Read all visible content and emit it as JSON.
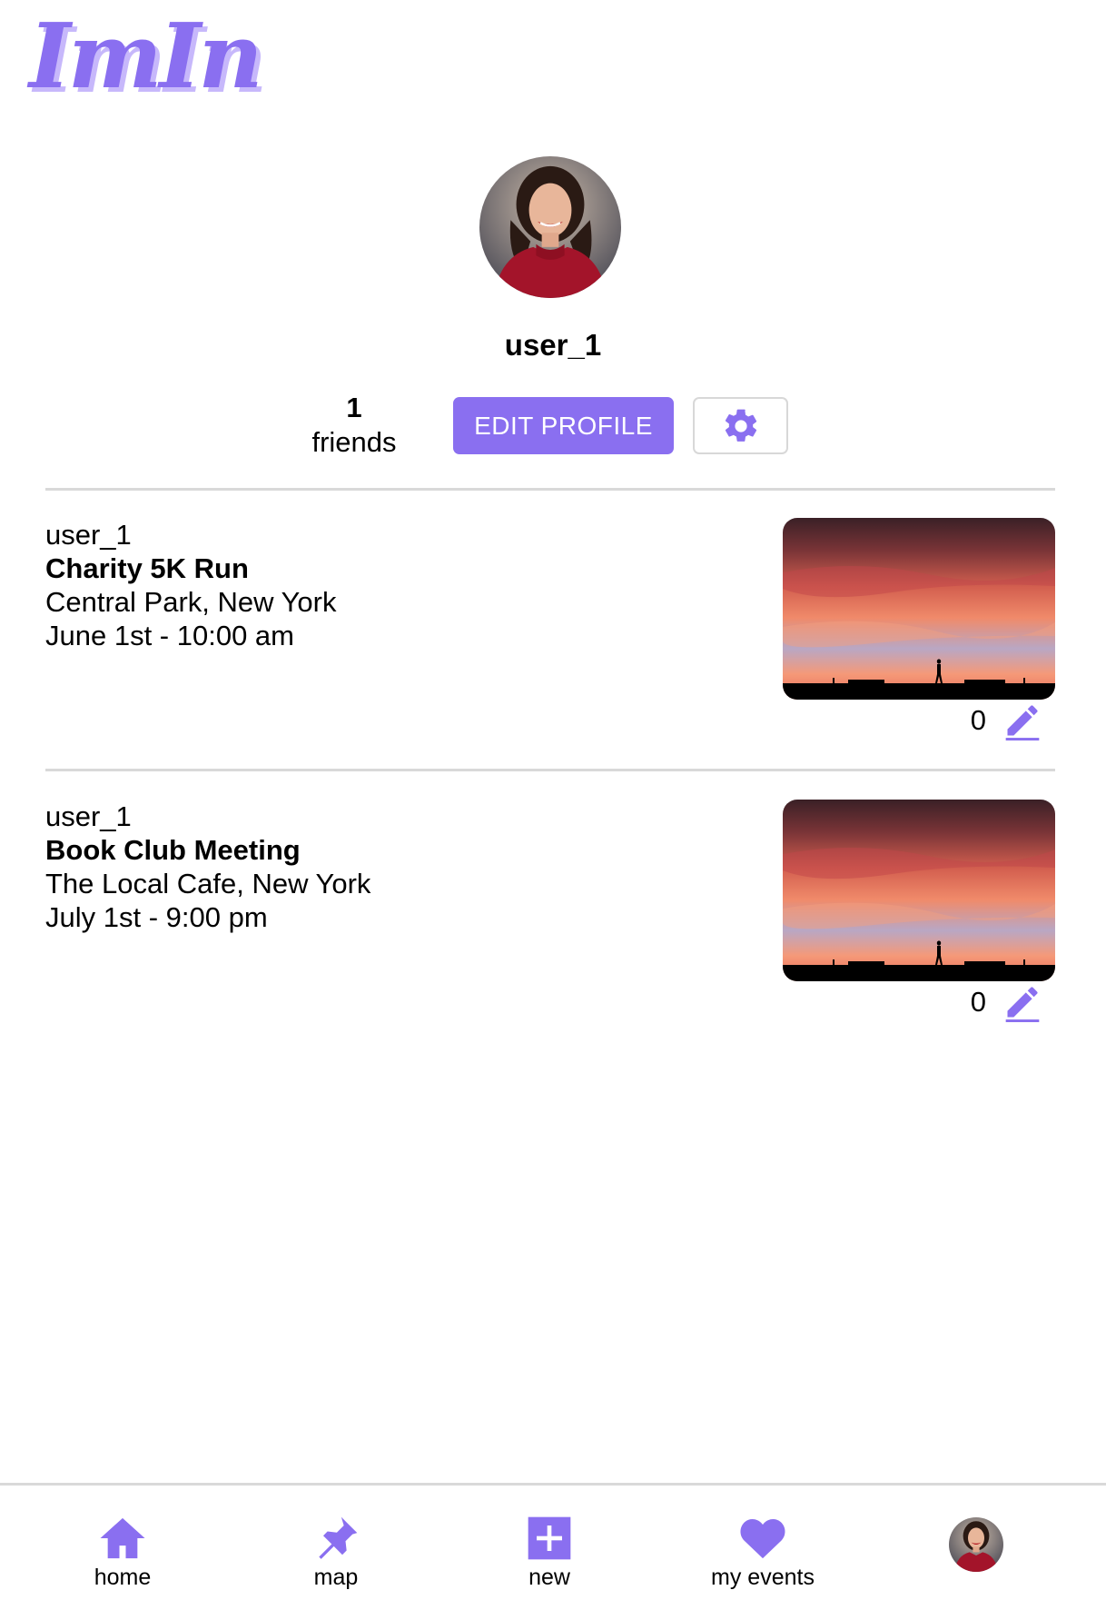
{
  "app": {
    "logo_text": "ImIn",
    "accent_color": "#8a6ff0"
  },
  "profile": {
    "username": "user_1",
    "friends_count": "1",
    "friends_label": "friends",
    "edit_profile_label": "EDIT PROFILE",
    "avatar_alt": "profile photo"
  },
  "events": [
    {
      "author": "user_1",
      "title": "Charity 5K Run",
      "location": "Central Park, New York",
      "datetime": "June 1st - 10:00 am",
      "count": "0",
      "image_alt": "sunset silhouette"
    },
    {
      "author": "user_1",
      "title": "Book Club Meeting",
      "location": "The Local Cafe, New York",
      "datetime": "July 1st - 9:00 pm",
      "count": "0",
      "image_alt": "sunset silhouette"
    }
  ],
  "nav": {
    "items": [
      {
        "label": "home",
        "icon": "home-icon"
      },
      {
        "label": "map",
        "icon": "pin-icon"
      },
      {
        "label": "new",
        "icon": "plus-icon"
      },
      {
        "label": "my events",
        "icon": "heart-icon"
      }
    ]
  }
}
